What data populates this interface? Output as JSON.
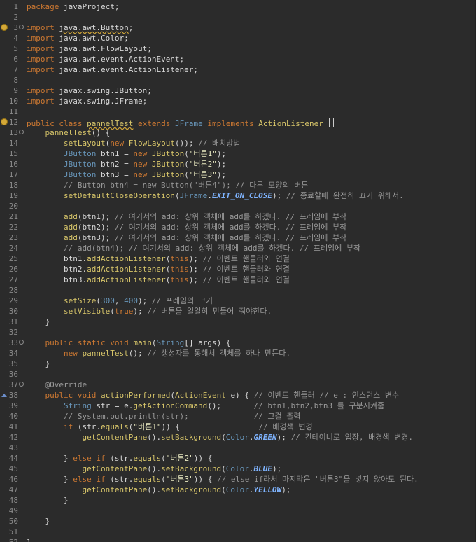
{
  "editor": {
    "lines": [
      {
        "n": "1",
        "tokens": [
          [
            "kw",
            "package"
          ],
          [
            "df",
            " javaProject;"
          ]
        ]
      },
      {
        "n": "2",
        "tokens": []
      },
      {
        "n": "3",
        "fold": true,
        "marker": "warn",
        "tokens": [
          [
            "kw",
            "import"
          ],
          [
            "df",
            " "
          ],
          [
            "warn",
            "java.awt.Button"
          ],
          [
            "df",
            ";"
          ]
        ]
      },
      {
        "n": "4",
        "tokens": [
          [
            "kw",
            "import"
          ],
          [
            "df",
            " java.awt.Color;"
          ]
        ]
      },
      {
        "n": "5",
        "tokens": [
          [
            "kw",
            "import"
          ],
          [
            "df",
            " java.awt.FlowLayout;"
          ]
        ]
      },
      {
        "n": "6",
        "tokens": [
          [
            "kw",
            "import"
          ],
          [
            "df",
            " java.awt.event.ActionEvent;"
          ]
        ]
      },
      {
        "n": "7",
        "tokens": [
          [
            "kw",
            "import"
          ],
          [
            "df",
            " java.awt.event.ActionListener;"
          ]
        ]
      },
      {
        "n": "8",
        "tokens": []
      },
      {
        "n": "9",
        "tokens": [
          [
            "kw",
            "import"
          ],
          [
            "df",
            " javax.swing.JButton;"
          ]
        ]
      },
      {
        "n": "10",
        "tokens": [
          [
            "kw",
            "import"
          ],
          [
            "df",
            " javax.swing.JFrame;"
          ]
        ]
      },
      {
        "n": "11",
        "tokens": []
      },
      {
        "n": "12",
        "marker": "warn",
        "caret": true,
        "tokens": [
          [
            "kw",
            "public"
          ],
          [
            "df",
            " "
          ],
          [
            "kw",
            "class"
          ],
          [
            "df",
            " "
          ],
          [
            "warncls",
            "pannelTest"
          ],
          [
            "df",
            " "
          ],
          [
            "kw",
            "extends"
          ],
          [
            "df",
            " "
          ],
          [
            "ty",
            "JFrame"
          ],
          [
            "df",
            " "
          ],
          [
            "kw",
            "implements"
          ],
          [
            "df",
            " "
          ],
          [
            "cls",
            "ActionListener"
          ],
          [
            "df",
            " "
          ]
        ]
      },
      {
        "n": "13",
        "fold": true,
        "tokens": [
          [
            "df",
            "    "
          ],
          [
            "cls",
            "pannelTest"
          ],
          [
            "df",
            "() {"
          ]
        ]
      },
      {
        "n": "14",
        "tokens": [
          [
            "df",
            "        "
          ],
          [
            "me",
            "setLayout"
          ],
          [
            "df",
            "("
          ],
          [
            "kw",
            "new"
          ],
          [
            "df",
            " "
          ],
          [
            "me",
            "FlowLayout"
          ],
          [
            "df",
            "()); "
          ],
          [
            "cm",
            "// 배치방법"
          ]
        ]
      },
      {
        "n": "15",
        "tokens": [
          [
            "df",
            "        "
          ],
          [
            "ty",
            "JButton"
          ],
          [
            "df",
            " btn1 = "
          ],
          [
            "kw",
            "new"
          ],
          [
            "df",
            " "
          ],
          [
            "me",
            "JButton"
          ],
          [
            "df",
            "("
          ],
          [
            "st",
            "\"버튼1\""
          ],
          [
            "df",
            ");"
          ]
        ]
      },
      {
        "n": "16",
        "tokens": [
          [
            "df",
            "        "
          ],
          [
            "ty",
            "JButton"
          ],
          [
            "df",
            " btn2 = "
          ],
          [
            "kw",
            "new"
          ],
          [
            "df",
            " "
          ],
          [
            "me",
            "JButton"
          ],
          [
            "df",
            "("
          ],
          [
            "st",
            "\"버튼2\""
          ],
          [
            "df",
            ");"
          ]
        ]
      },
      {
        "n": "17",
        "tokens": [
          [
            "df",
            "        "
          ],
          [
            "ty",
            "JButton"
          ],
          [
            "df",
            " btn3 = "
          ],
          [
            "kw",
            "new"
          ],
          [
            "df",
            " "
          ],
          [
            "me",
            "JButton"
          ],
          [
            "df",
            "("
          ],
          [
            "st",
            "\"버튼3\""
          ],
          [
            "df",
            ");"
          ]
        ]
      },
      {
        "n": "18",
        "tokens": [
          [
            "df",
            "        "
          ],
          [
            "cm",
            "// Button btn4 = new Button(\"버튼4\"); // 다른 모양의 버튼"
          ]
        ]
      },
      {
        "n": "19",
        "tokens": [
          [
            "df",
            "        "
          ],
          [
            "me",
            "setDefaultCloseOperation"
          ],
          [
            "df",
            "("
          ],
          [
            "ty",
            "JFrame"
          ],
          [
            "df",
            "."
          ],
          [
            "fi",
            "EXIT_ON_CLOSE"
          ],
          [
            "df",
            "); "
          ],
          [
            "cm",
            "// 종료할때 완전히 끄기 위해서."
          ]
        ]
      },
      {
        "n": "20",
        "tokens": []
      },
      {
        "n": "21",
        "tokens": [
          [
            "df",
            "        "
          ],
          [
            "me",
            "add"
          ],
          [
            "df",
            "(btn1); "
          ],
          [
            "cm",
            "// 여기서의 add: 상위 객체에 add를 하겠다. // 프레임에 부착"
          ]
        ]
      },
      {
        "n": "22",
        "tokens": [
          [
            "df",
            "        "
          ],
          [
            "me",
            "add"
          ],
          [
            "df",
            "(btn2); "
          ],
          [
            "cm",
            "// 여기서의 add: 상위 객체에 add를 하겠다. // 프레임에 부착"
          ]
        ]
      },
      {
        "n": "23",
        "tokens": [
          [
            "df",
            "        "
          ],
          [
            "me",
            "add"
          ],
          [
            "df",
            "(btn3); "
          ],
          [
            "cm",
            "// 여기서의 add: 상위 객체에 add를 하겠다. // 프레임에 부착"
          ]
        ]
      },
      {
        "n": "24",
        "tokens": [
          [
            "df",
            "        "
          ],
          [
            "cm",
            "// add(btn4); // 여기서의 add: 상위 객체에 add를 하겠다. // 프레임에 부착"
          ]
        ]
      },
      {
        "n": "25",
        "tokens": [
          [
            "df",
            "        btn1."
          ],
          [
            "me",
            "addActionListener"
          ],
          [
            "df",
            "("
          ],
          [
            "kw",
            "this"
          ],
          [
            "df",
            "); "
          ],
          [
            "cm",
            "// 이벤트 핸들러와 연결"
          ]
        ]
      },
      {
        "n": "26",
        "tokens": [
          [
            "df",
            "        btn2."
          ],
          [
            "me",
            "addActionListener"
          ],
          [
            "df",
            "("
          ],
          [
            "kw",
            "this"
          ],
          [
            "df",
            "); "
          ],
          [
            "cm",
            "// 이벤트 핸들러와 연결"
          ]
        ]
      },
      {
        "n": "27",
        "tokens": [
          [
            "df",
            "        btn3."
          ],
          [
            "me",
            "addActionListener"
          ],
          [
            "df",
            "("
          ],
          [
            "kw",
            "this"
          ],
          [
            "df",
            "); "
          ],
          [
            "cm",
            "// 이벤트 핸들러와 연결"
          ]
        ]
      },
      {
        "n": "28",
        "tokens": []
      },
      {
        "n": "29",
        "tokens": [
          [
            "df",
            "        "
          ],
          [
            "me",
            "setSize"
          ],
          [
            "df",
            "("
          ],
          [
            "nm",
            "300"
          ],
          [
            "df",
            ", "
          ],
          [
            "nm",
            "400"
          ],
          [
            "df",
            "); "
          ],
          [
            "cm",
            "// 프레임의 크기"
          ]
        ]
      },
      {
        "n": "30",
        "tokens": [
          [
            "df",
            "        "
          ],
          [
            "me",
            "setVisible"
          ],
          [
            "df",
            "("
          ],
          [
            "kw",
            "true"
          ],
          [
            "df",
            "); "
          ],
          [
            "cm",
            "// 버튼을 일일히 만들어 줘야한다."
          ]
        ]
      },
      {
        "n": "31",
        "tokens": [
          [
            "df",
            "    }"
          ]
        ]
      },
      {
        "n": "32",
        "tokens": []
      },
      {
        "n": "33",
        "fold": true,
        "tokens": [
          [
            "df",
            "    "
          ],
          [
            "kw",
            "public"
          ],
          [
            "df",
            " "
          ],
          [
            "kw",
            "static"
          ],
          [
            "df",
            " "
          ],
          [
            "kw",
            "void"
          ],
          [
            "df",
            " "
          ],
          [
            "me",
            "main"
          ],
          [
            "df",
            "("
          ],
          [
            "ty",
            "String"
          ],
          [
            "df",
            "[] args) {"
          ]
        ]
      },
      {
        "n": "34",
        "tokens": [
          [
            "df",
            "        "
          ],
          [
            "kw",
            "new"
          ],
          [
            "df",
            " "
          ],
          [
            "cls",
            "pannelTest"
          ],
          [
            "df",
            "(); "
          ],
          [
            "cm",
            "// 생성자를 통해서 객체를 하나 만든다."
          ]
        ]
      },
      {
        "n": "35",
        "tokens": [
          [
            "df",
            "    }"
          ]
        ]
      },
      {
        "n": "36",
        "tokens": []
      },
      {
        "n": "37",
        "fold": true,
        "tokens": [
          [
            "df",
            "    "
          ],
          [
            "an",
            "@Override"
          ]
        ]
      },
      {
        "n": "38",
        "marker": "over",
        "tokens": [
          [
            "df",
            "    "
          ],
          [
            "kw",
            "public"
          ],
          [
            "df",
            " "
          ],
          [
            "kw",
            "void"
          ],
          [
            "df",
            " "
          ],
          [
            "me",
            "actionPerformed"
          ],
          [
            "df",
            "("
          ],
          [
            "cls",
            "ActionEvent"
          ],
          [
            "df",
            " e) { "
          ],
          [
            "cm",
            "// 이벤트 핸들러 // e : 인스턴스 변수"
          ]
        ]
      },
      {
        "n": "39",
        "tokens": [
          [
            "df",
            "        "
          ],
          [
            "ty",
            "String"
          ],
          [
            "df",
            " str = e."
          ],
          [
            "me",
            "getActionCommand"
          ],
          [
            "df",
            "();       "
          ],
          [
            "cm",
            "// btn1,btn2,btn3 를 구분시켜줌"
          ]
        ]
      },
      {
        "n": "40",
        "tokens": [
          [
            "df",
            "        "
          ],
          [
            "cm",
            "// System.out.println(str);              // 그걸 출력"
          ]
        ]
      },
      {
        "n": "41",
        "tokens": [
          [
            "df",
            "        "
          ],
          [
            "kw",
            "if"
          ],
          [
            "df",
            " (str."
          ],
          [
            "me",
            "equals"
          ],
          [
            "df",
            "("
          ],
          [
            "st",
            "\"버튼1\""
          ],
          [
            "df",
            ")) {                 "
          ],
          [
            "cm",
            "// 배경색 변경"
          ]
        ]
      },
      {
        "n": "42",
        "tokens": [
          [
            "df",
            "            "
          ],
          [
            "me",
            "getContentPane"
          ],
          [
            "df",
            "()."
          ],
          [
            "me",
            "setBackground"
          ],
          [
            "df",
            "("
          ],
          [
            "ty",
            "Color"
          ],
          [
            "df",
            "."
          ],
          [
            "fi",
            "GREEN"
          ],
          [
            "df",
            "); "
          ],
          [
            "cm",
            "// 컨테이너로 입장, 배경색 변경."
          ]
        ]
      },
      {
        "n": "43",
        "tokens": []
      },
      {
        "n": "44",
        "tokens": [
          [
            "df",
            "        } "
          ],
          [
            "kw",
            "else"
          ],
          [
            "df",
            " "
          ],
          [
            "kw",
            "if"
          ],
          [
            "df",
            " (str."
          ],
          [
            "me",
            "equals"
          ],
          [
            "df",
            "("
          ],
          [
            "st",
            "\"버튼2\""
          ],
          [
            "df",
            ")) {"
          ]
        ]
      },
      {
        "n": "45",
        "tokens": [
          [
            "df",
            "            "
          ],
          [
            "me",
            "getContentPane"
          ],
          [
            "df",
            "()."
          ],
          [
            "me",
            "setBackground"
          ],
          [
            "df",
            "("
          ],
          [
            "ty",
            "Color"
          ],
          [
            "df",
            "."
          ],
          [
            "fi",
            "BLUE"
          ],
          [
            "df",
            ");"
          ]
        ]
      },
      {
        "n": "46",
        "tokens": [
          [
            "df",
            "        } "
          ],
          [
            "kw",
            "else"
          ],
          [
            "df",
            " "
          ],
          [
            "kw",
            "if"
          ],
          [
            "df",
            " (str."
          ],
          [
            "me",
            "equals"
          ],
          [
            "df",
            "("
          ],
          [
            "st",
            "\"버튼3\""
          ],
          [
            "df",
            ")) { "
          ],
          [
            "cm",
            "// else if라서 마지막은 \"버튼3\"을 넣지 않아도 된다."
          ]
        ]
      },
      {
        "n": "47",
        "tokens": [
          [
            "df",
            "            "
          ],
          [
            "me",
            "getContentPane"
          ],
          [
            "df",
            "()."
          ],
          [
            "me",
            "setBackground"
          ],
          [
            "df",
            "("
          ],
          [
            "ty",
            "Color"
          ],
          [
            "df",
            "."
          ],
          [
            "fi",
            "YELLOW"
          ],
          [
            "df",
            ");"
          ]
        ]
      },
      {
        "n": "48",
        "tokens": [
          [
            "df",
            "        }"
          ]
        ]
      },
      {
        "n": "49",
        "tokens": []
      },
      {
        "n": "50",
        "tokens": [
          [
            "df",
            "    }"
          ]
        ]
      },
      {
        "n": "51",
        "tokens": []
      },
      {
        "n": "52",
        "tokens": [
          [
            "df",
            "}"
          ]
        ]
      }
    ]
  },
  "icons": {
    "fold": "fold-toggle-icon",
    "warn": "warning-lightbulb-icon",
    "over": "override-arrow-icon"
  },
  "colors": {
    "background": "#2b2b2b",
    "keyword": "#cc7832",
    "type": "#6896ba",
    "method": "#d8c66a",
    "comment": "#9a9a9a",
    "number": "#6897bb",
    "constant": "#7fb4ff"
  }
}
